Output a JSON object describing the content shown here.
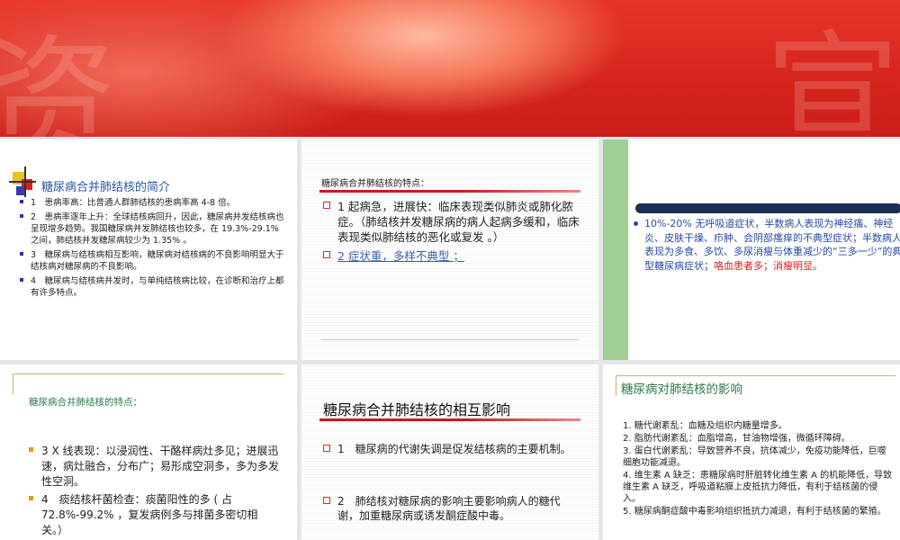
{
  "banner": {
    "glyph_left": "资",
    "glyph_right": "宣"
  },
  "slide1": {
    "title": "糖尿病合并肺结核的简介",
    "items": [
      "1　患病率高：比普通人群肺结核的患病率高 4-8 倍。",
      "2　患病率逐年上升：全球结核病回升，因此，糖尿病并发结核病也呈现增多趋势。我国糖尿病并发肺结核也较多，在 19.3%-29.1% 之间，肺结核并发糖尿病较少为 1.35% 。",
      "3　糖尿病与结核病相互影响，糖尿病对结核病的不良影响明显大于结核病对糖尿病的不良影响。",
      "4　糖尿病与结核病并发时，与单纯结核病比较，在诊断和治疗上都有许多特点。"
    ]
  },
  "slide2": {
    "title": "糖尿病合并肺结核的特点：",
    "items": [
      "1 起病急，进展快：临床表现类似肺炎或肺化脓症。（肺结核并发糖尿病的病人起病多缓和，临床表现类似肺结核的恶化或复发 。）",
      "2 症状重，多样不典型 ；"
    ]
  },
  "slide3": {
    "text_main": "10%-20% 无呼吸道症状，半数病人表现为神经痛、神经炎、皮肤干燥、疖肿、会阴部瘙痒的不典型症状；半数病人表现为多食、多饮、多尿消瘦与体重减少的“三多一少”的典型糖尿病症状；",
    "text_red": "咯血患者多；消瘦明显。"
  },
  "slide4": {
    "title": "糖尿病合并肺结核的特点：",
    "items": [
      "3 X 线表现：以浸润性、干酪样病灶多见；进展迅速，病灶融合，分布广；易形成空洞多，多为多发性空洞。",
      "4　痰结核杆菌检查：痰菌阳性的多 ( 占 72.8%-99.2% ，复发病例多与排菌多密切相关。）"
    ]
  },
  "slide5": {
    "title": "糖尿病合并肺结核的相互影响",
    "items": [
      "1　糖尿病的代谢失调是促发结核病的主要机制。",
      "2　肺结核对糖尿病的影响主要影响病人的糖代谢，加重糖尿病或诱发酮症酸中毒。"
    ]
  },
  "slide6": {
    "title": "糖尿病对肺结核的影响",
    "items": [
      "1. 糖代谢紊乱：血糖及组织内糖量增多。",
      "2. 脂肪代谢紊乱：血脂增高，甘油物增强，微循环障碍。",
      "3. 蛋白代谢紊乱：导致营养不良，抗体减少，免疫功能降低，巨噬细胞功能减退。",
      "4. 维生素 A 缺乏：患糖尿病时肝脏转化维生素 A 的机能降低，导致维生素 A 缺乏，呼吸道粘膜上皮抵抗力降低，有利于结核菌的侵入。",
      "5. 糖尿病酮症酸中毒影响组织抵抗力减退，有利于结核菌的繁殖。"
    ]
  },
  "colors": {
    "accent_red": "#d42020",
    "title_blue": "#2a56a8",
    "title_green": "#2e7a4a"
  }
}
